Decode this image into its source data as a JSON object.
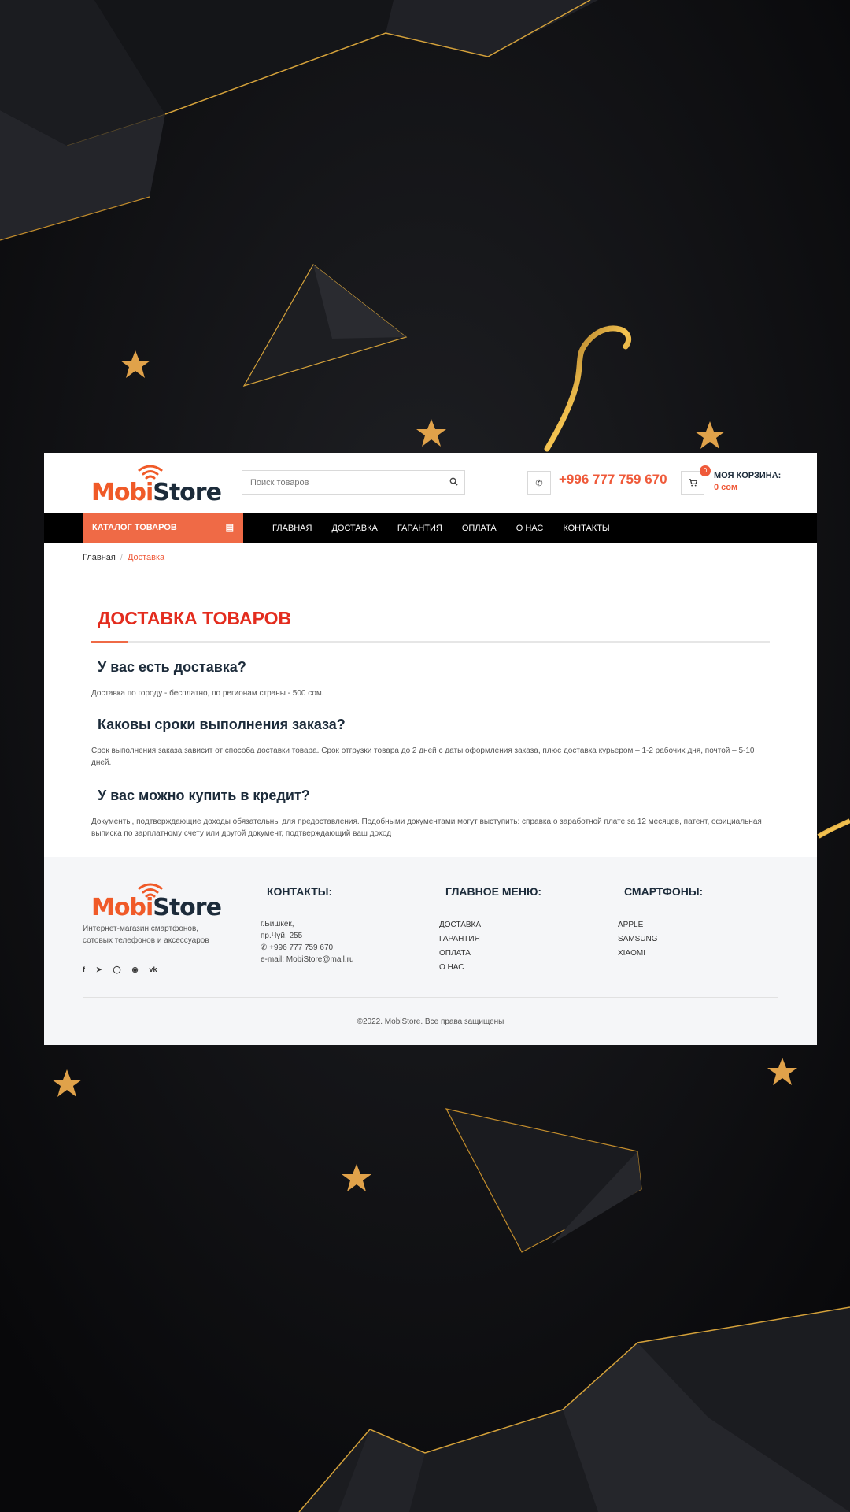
{
  "brand": {
    "part1": "Mobi",
    "part2": "Store",
    "accent": "#ef5a3a",
    "dark": "#1c2b3a"
  },
  "search": {
    "placeholder": "Поиск товаров",
    "icon": "search-icon"
  },
  "header": {
    "phone": "+996 777 759 670",
    "cart_count": "0",
    "cart_title": "МОЯ КОРЗИНА:",
    "cart_sum": "0 сом"
  },
  "nav": {
    "catalog_label": "КАТАЛОГ ТОВАРОВ",
    "items": [
      "ГЛАВНАЯ",
      "ДОСТАВКА",
      "ГАРАНТИЯ",
      "ОПЛАТА",
      "О НАС",
      "КОНТАКТЫ"
    ]
  },
  "breadcrumb": {
    "home": "Главная",
    "sep": "/",
    "current": "Доставка"
  },
  "content": {
    "title": "ДОСТАВКА ТОВАРОВ",
    "faq": [
      {
        "q": "У вас есть доставка?",
        "a": "Доставка по городу - бесплатно, по регионам страны - 500 сом."
      },
      {
        "q": "Каковы сроки выполнения заказа?",
        "a": "Срок выполнения заказа зависит от способа доставки товара. Срок отгрузки товара до 2 дней с даты оформления заказа, плюс доставка курьером – 1-2 рабочих дня, почтой – 5-10 дней."
      },
      {
        "q": "У вас можно купить в кредит?",
        "a": "Документы, подтверждающие доходы обязательны для предоставления. Подобными документами могут выступить: справка о заработной плате за 12 месяцев, патент, официальная выписка по зарплатному счету или другой документ, подтверждающий ваш доход"
      }
    ]
  },
  "footer": {
    "description": "Интернет-магазин смартфонов, сотовых телефонов и аксессуаров",
    "social": [
      "f",
      "twitter",
      "instagram",
      "pinterest",
      "vk"
    ],
    "contacts": {
      "title": "КОНТАКТЫ:",
      "city": "г.Бишкек,",
      "street": "пр.Чуй, 255",
      "phone": "+996 777 759 670",
      "email": "e-mail: MobiStore@mail.ru"
    },
    "main_menu": {
      "title": "ГЛАВНОЕ МЕНЮ:",
      "items": [
        "ДОСТАВКА",
        "ГАРАНТИЯ",
        "ОПЛАТА",
        "О НАС"
      ]
    },
    "phones": {
      "title": "СМАРТФОНЫ:",
      "items": [
        "APPLE",
        "SAMSUNG",
        "XIAOMI"
      ]
    },
    "copyright": "©2022. MobiStore. Все права защищены"
  }
}
